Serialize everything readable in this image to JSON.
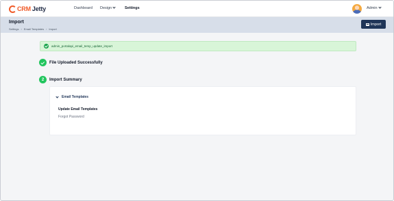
{
  "app": {
    "logo_text_primary": "CRM",
    "logo_text_secondary": "Jetty"
  },
  "nav": {
    "items": [
      {
        "label": "Dashboard"
      },
      {
        "label": "Design"
      },
      {
        "label": "Settings"
      }
    ],
    "user_label": "Admin"
  },
  "header": {
    "title": "Import",
    "breadcrumb": [
      "Settings",
      "Email Templates",
      "Import"
    ],
    "import_button_label": "Import"
  },
  "alert": {
    "message": "admin_portalapi_email_temp_update_import"
  },
  "steps": [
    {
      "number": "",
      "label": "File Uploaded Successfully",
      "status": "done"
    },
    {
      "number": "2",
      "label": "Import Summary",
      "status": "active"
    }
  ],
  "summary": {
    "section_label": "Email Templates",
    "group_title": "Update Email Templates",
    "items": [
      "Forgot Password"
    ]
  },
  "colors": {
    "brand_orange": "#f05a28",
    "brand_navy": "#1f3558",
    "success_green": "#22c55e",
    "alert_bg": "#d8f5d8",
    "header_bg": "#d7dee9"
  }
}
